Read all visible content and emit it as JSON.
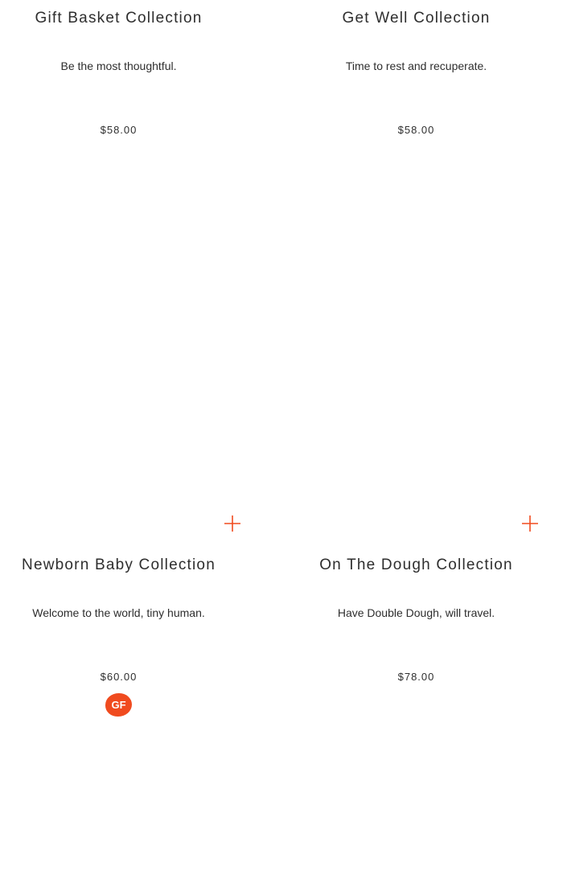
{
  "products": [
    {
      "title": "Gift Basket Collection",
      "description": "Be the most thoughtful.",
      "price": "$58.00",
      "badge": ""
    },
    {
      "title": "Get Well Collection",
      "description": "Time to rest and recuperate.",
      "price": "$58.00",
      "badge": ""
    },
    {
      "title": "Newborn Baby Collection",
      "description": "Welcome to the world, tiny human.",
      "price": "$60.00",
      "badge": "GF"
    },
    {
      "title": "On The Dough Collection",
      "description": "Have Double Dough, will travel.",
      "price": "$78.00",
      "badge": ""
    }
  ],
  "add_buttons": [
    {
      "icon": "plus-icon"
    },
    {
      "icon": "plus-icon"
    }
  ],
  "colors": {
    "accent": "#f04b1f",
    "text": "#2e2e2e",
    "background": "#ffffff"
  }
}
